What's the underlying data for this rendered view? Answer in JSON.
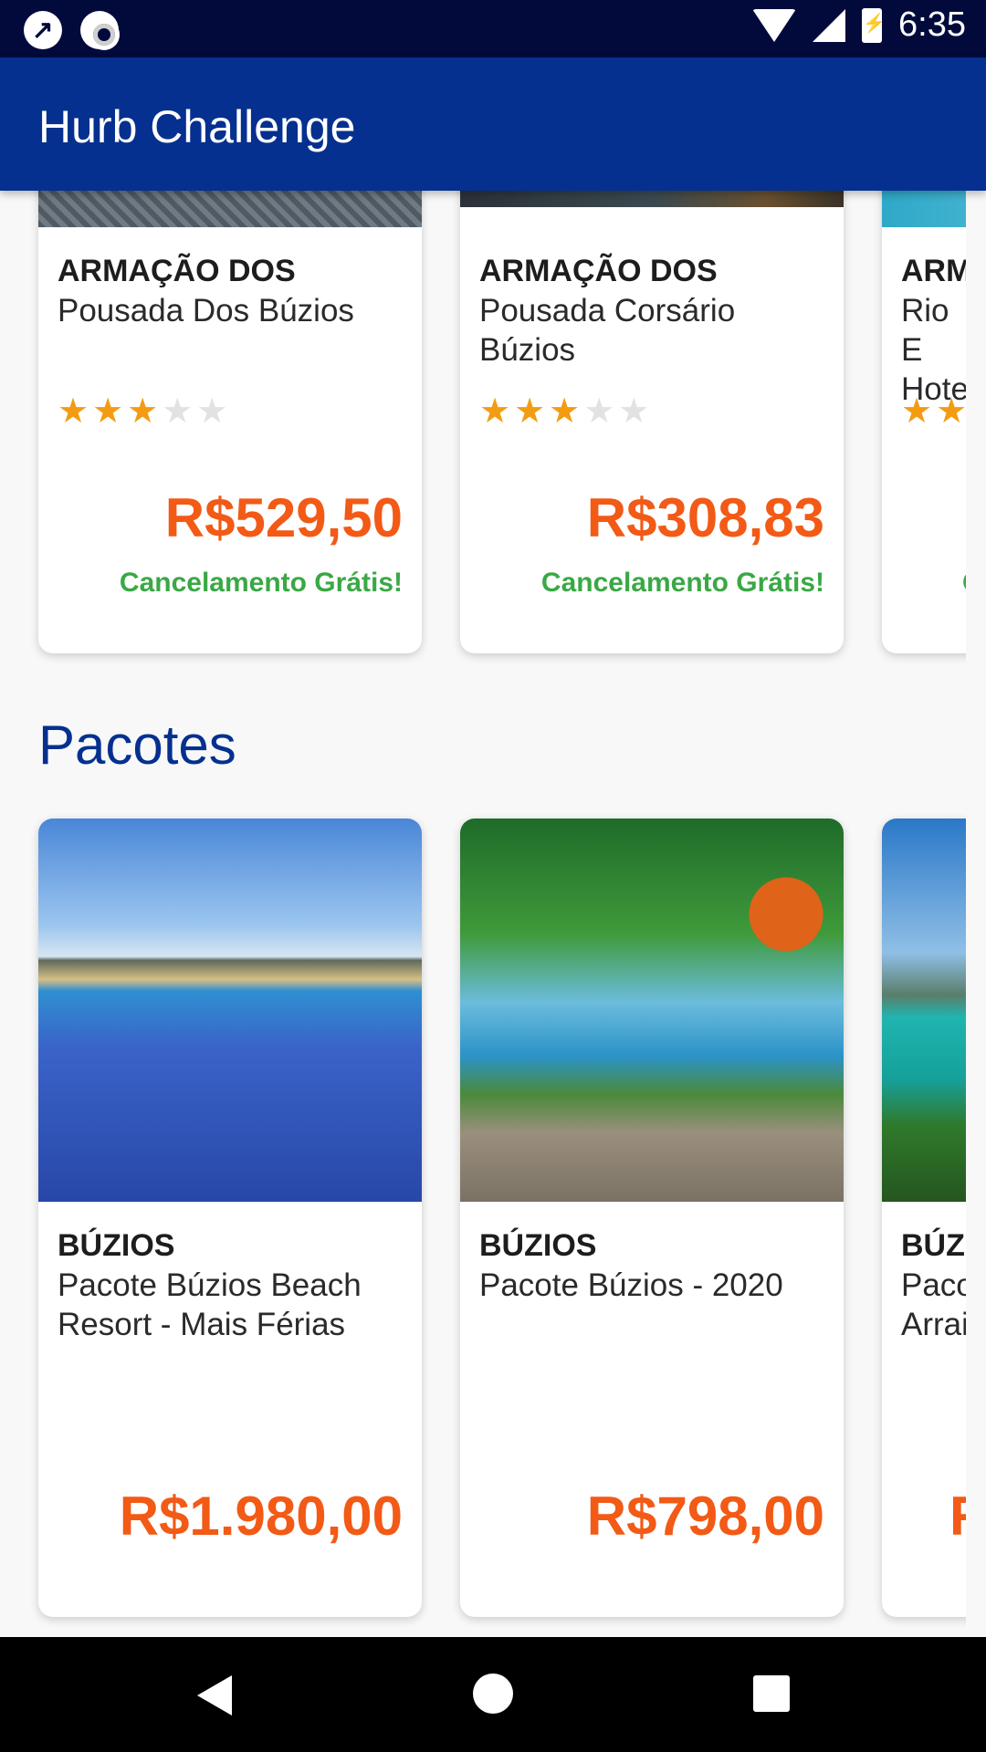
{
  "status_bar": {
    "time": "6:35",
    "icons": [
      "tool-icon",
      "record-icon",
      "wifi-icon",
      "signal-icon",
      "battery-charging-icon"
    ]
  },
  "app_bar": {
    "title": "Hurb Challenge"
  },
  "hotels": [
    {
      "city": "ARMAÇÃO DOS",
      "name": "Pousada Dos Búzios",
      "rating": 3,
      "price": "R$529,50",
      "badge": "Cancelamento Grátis!"
    },
    {
      "city": "ARMAÇÃO DOS",
      "name": "Pousada Corsário Búzios",
      "rating": 3,
      "price": "R$308,83",
      "badge": "Cancelamento Grátis!"
    },
    {
      "city": "ARM",
      "name": "Rio E Hote",
      "rating": 3,
      "price": "",
      "badge": "C"
    }
  ],
  "packages_section": {
    "title": "Pacotes"
  },
  "packages": [
    {
      "city": "BÚZIOS",
      "name": "Pacote Búzios Beach Resort - Mais Férias",
      "price": "R$1.980,00"
    },
    {
      "city": "BÚZIOS",
      "name": "Pacote Búzios - 2020",
      "price": "R$798,00"
    },
    {
      "city": "BÚZ",
      "name": "Paco Arrai",
      "price": "R"
    }
  ],
  "colors": {
    "app_bar": "#05308f",
    "status_bar": "#020a3c",
    "price": "#f25a16",
    "badge": "#3aa845",
    "star": "#f39c12"
  }
}
